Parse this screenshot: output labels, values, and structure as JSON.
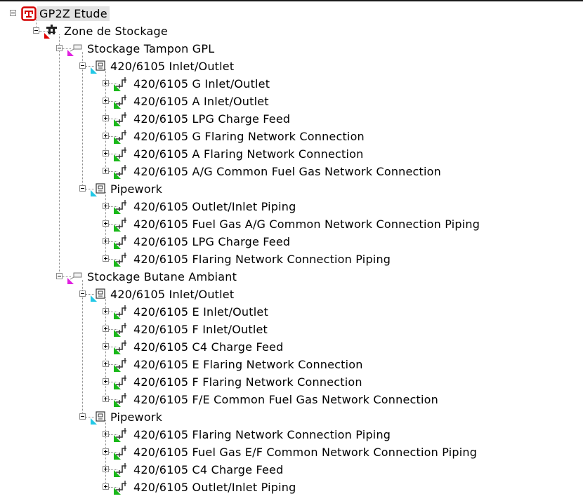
{
  "tree": {
    "root": {
      "label": "GP2Z Etude",
      "icon": "study-icon",
      "zone": {
        "label": "Zone de Stockage",
        "icon": "zone-icon",
        "areas": [
          {
            "label": "Stockage Tampon GPL",
            "icon": "area-icon",
            "groups": [
              {
                "label": "420/6105 Inlet/Outlet",
                "icon": "unit-icon",
                "items": [
                  "420/6105 G Inlet/Outlet",
                  "420/6105 A Inlet/Outlet",
                  "420/6105 LPG Charge Feed",
                  "420/6105 G Flaring Network Connection",
                  "420/6105 A Flaring Network Connection",
                  "420/6105 A/G Common Fuel Gas Network Connection"
                ]
              },
              {
                "label": "Pipework",
                "icon": "unit-icon",
                "items": [
                  "420/6105 Outlet/Inlet Piping",
                  "420/6105 Fuel Gas A/G Common Network Connection Piping",
                  "420/6105 LPG Charge Feed",
                  "420/6105 Flaring Network Connection Piping"
                ]
              }
            ]
          },
          {
            "label": "Stockage Butane Ambiant",
            "icon": "area-icon",
            "groups": [
              {
                "label": "420/6105 Inlet/Outlet",
                "icon": "unit-icon",
                "items": [
                  "420/6105 E Inlet/Outlet",
                  "420/6105 F Inlet/Outlet",
                  "420/6105 C4 Charge Feed",
                  "420/6105 E Flaring Network Connection",
                  "420/6105 F Flaring Network Connection",
                  "420/6105 F/E Common Fuel Gas Network Connection"
                ]
              },
              {
                "label": "Pipework",
                "icon": "unit-icon",
                "items": [
                  "420/6105 Flaring Network Connection Piping",
                  "420/6105 Fuel Gas E/F Common Network Connection Piping",
                  "420/6105 C4 Charge Feed",
                  "420/6105 Outlet/Inlet Piping"
                ]
              }
            ]
          }
        ]
      }
    },
    "item_icon": "pipe-icon",
    "colors": {
      "root_badge": "#d40000",
      "zone_marker": "#e00000",
      "area_marker": "#e020e0",
      "unit_marker": "#22c8e6",
      "pipe_marker": "#19b819",
      "selection": "#e3e3e3",
      "connector": "#8a8a8a"
    }
  }
}
